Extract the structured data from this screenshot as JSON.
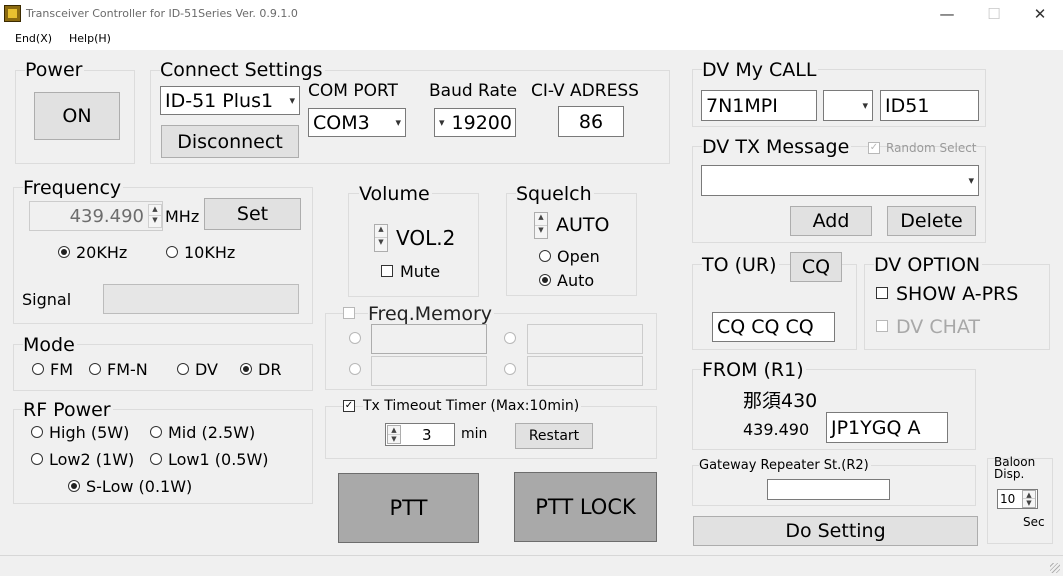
{
  "window": {
    "title": "Transceiver Controller for ID-51Series  Ver. 0.9.1.0",
    "minimize": "—",
    "maximize": "☐",
    "close": "✕"
  },
  "menu": {
    "end": "End(X)",
    "help": "Help(H)"
  },
  "power": {
    "label": "Power",
    "button": "ON"
  },
  "connect": {
    "label": "Connect Settings",
    "model": "ID-51 Plus1",
    "disconnect": "Disconnect",
    "com_label": "COM PORT",
    "com_value": "COM3",
    "baud_label": "Baud Rate",
    "baud_value": "19200",
    "civ_label": "CI-V ADRESS",
    "civ_value": "86"
  },
  "frequency": {
    "label": "Frequency",
    "value": "439.490",
    "unit": "MHz",
    "set": "Set",
    "step_20": "20KHz",
    "step_10": "10KHz",
    "signal_label": "Signal",
    "selected_step": "20KHz"
  },
  "volume": {
    "label": "Volume",
    "value": "VOL.2",
    "mute": "Mute"
  },
  "squelch": {
    "label": "Squelch",
    "value": "AUTO",
    "open": "Open",
    "auto": "Auto",
    "selected": "Auto"
  },
  "mode": {
    "label": "Mode",
    "options": [
      "FM",
      "FM-N",
      "DV",
      "DR"
    ],
    "selected": "DR"
  },
  "rf_power": {
    "label": "RF Power",
    "high": "High (5W)",
    "mid": "Mid (2.5W)",
    "low2": "Low2 (1W)",
    "low1": "Low1 (0.5W)",
    "slow": "S-Low (0.1W)",
    "selected": "S-Low (0.1W)"
  },
  "freq_memory": {
    "label": "Freq.Memory"
  },
  "timeout": {
    "label": "Tx Timeout Timer (Max:10min)",
    "value": "3",
    "unit": "min",
    "restart": "Restart",
    "checked": true
  },
  "ptt": {
    "ptt": "PTT",
    "ptt_lock": "PTT LOCK"
  },
  "dv_mycall": {
    "label": "DV My CALL",
    "call": "7N1MPI",
    "suffix": "ID51"
  },
  "dv_tx_message": {
    "label": "DV TX Message",
    "random_select": "Random Select",
    "add": "Add",
    "delete": "Delete"
  },
  "to_ur": {
    "label": "TO (UR)",
    "cq_button": "CQ",
    "value": "CQ CQ CQ"
  },
  "dv_option": {
    "label": "DV OPTION",
    "show_aprs": "SHOW A-PRS",
    "dv_chat": "DV CHAT"
  },
  "from_r1": {
    "label": "FROM (R1)",
    "name": "那須430",
    "freq": "439.490",
    "call": "JP1YGQ A"
  },
  "gateway": {
    "label": "Gateway Repeater St.(R2)",
    "value": ""
  },
  "do_setting": "Do Setting",
  "balloon": {
    "label_line1": "Baloon",
    "label_line2": "Disp.",
    "value": "10",
    "unit": "Sec"
  },
  "icons": {
    "dropdown": "▾",
    "spin_up": "▲",
    "spin_down": "▼",
    "check": "✓"
  }
}
